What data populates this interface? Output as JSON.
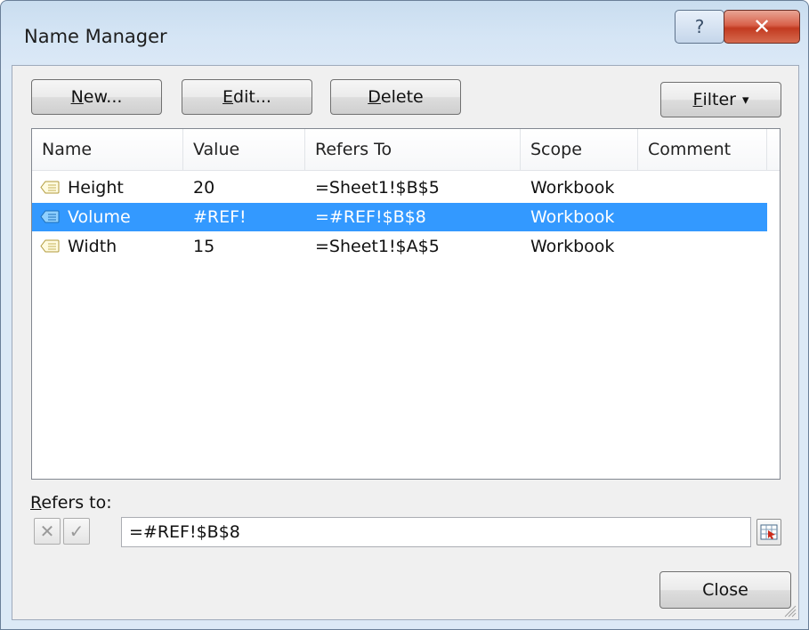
{
  "window": {
    "title": "Name Manager",
    "help_glyph": "?",
    "close_glyph": "✕"
  },
  "toolbar": {
    "new_label_ul": "N",
    "new_label_rest": "ew...",
    "edit_label_ul": "E",
    "edit_label_rest": "dit...",
    "delete_label_ul": "D",
    "delete_label_rest": "elete",
    "filter_label_ul": "F",
    "filter_label_rest": "ilter",
    "filter_arrow": "▾"
  },
  "list": {
    "columns": [
      "Name",
      "Value",
      "Refers To",
      "Scope",
      "Comment"
    ],
    "rows": [
      {
        "name": "Height",
        "value": "20",
        "refers_to": "=Sheet1!$B$5",
        "scope": "Workbook",
        "comment": "",
        "selected": false
      },
      {
        "name": "Volume",
        "value": "#REF!",
        "refers_to": "=#REF!$B$8",
        "scope": "Workbook",
        "comment": "",
        "selected": true
      },
      {
        "name": "Width",
        "value": "15",
        "refers_to": "=Sheet1!$A$5",
        "scope": "Workbook",
        "comment": "",
        "selected": false
      }
    ]
  },
  "refers_to": {
    "label_ul": "R",
    "label_rest": "efers to:",
    "cancel_glyph": "✕",
    "enter_glyph": "✓",
    "value": "=#REF!$B$8"
  },
  "footer": {
    "close_label": "Close"
  },
  "colors": {
    "selection": "#3399ff",
    "close_button": "#c23a20"
  },
  "icons": {
    "help": "question-mark-icon",
    "close": "close-icon",
    "name_tag": "name-tag-icon",
    "collapse": "range-selector-icon",
    "grip": "resize-grip-icon"
  }
}
